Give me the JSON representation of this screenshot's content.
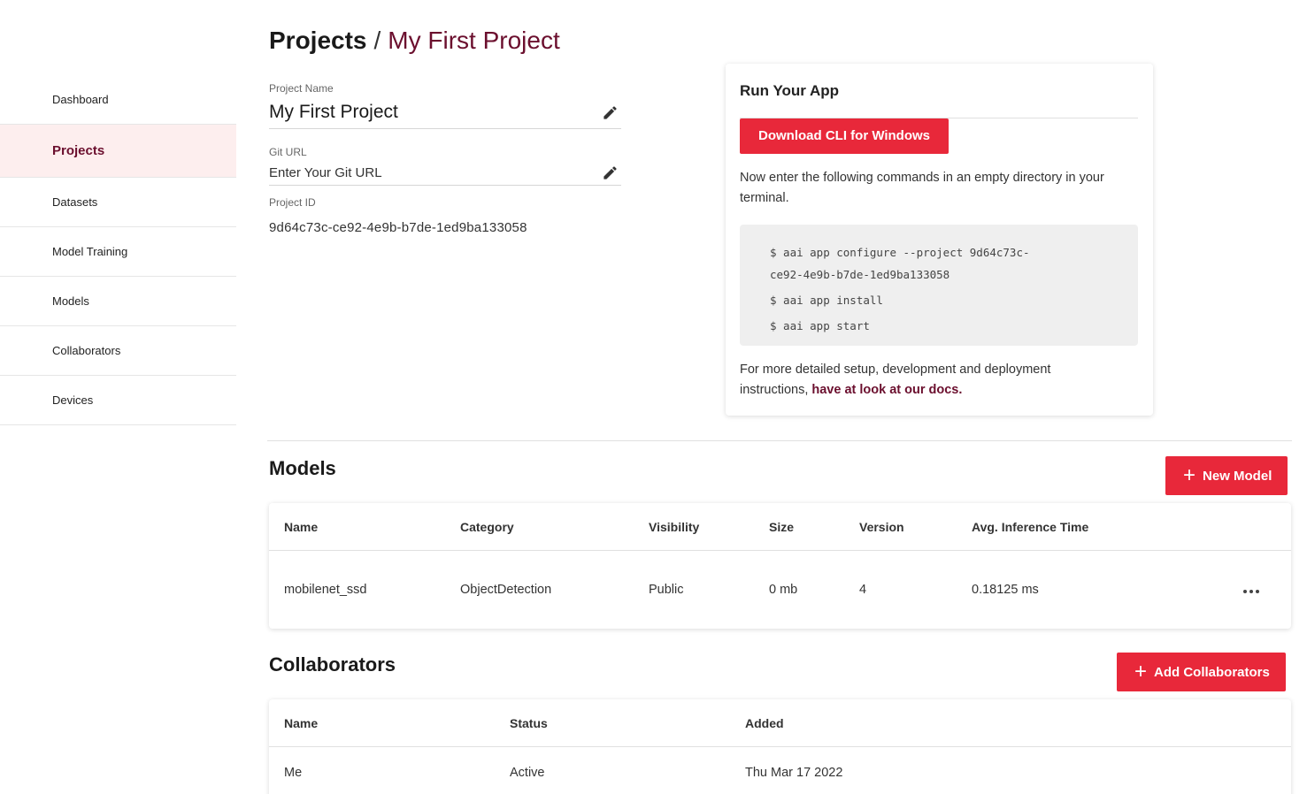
{
  "sidebar": {
    "items": [
      {
        "label": "Dashboard"
      },
      {
        "label": "Projects"
      },
      {
        "label": "Datasets"
      },
      {
        "label": "Model Training"
      },
      {
        "label": "Models"
      },
      {
        "label": "Collaborators"
      },
      {
        "label": "Devices"
      }
    ],
    "active": "Projects"
  },
  "header": {
    "breadcrumb_root": "Projects",
    "separator": "/",
    "breadcrumb_current": "My First Project"
  },
  "project": {
    "name_label": "Project Name",
    "name_value": "My First Project",
    "git_label": "Git URL",
    "git_placeholder": "Enter Your Git URL",
    "id_label": "Project ID",
    "id_value": "9d64c73c-ce92-4e9b-b7de-1ed9ba133058"
  },
  "run_app": {
    "title": "Run Your App",
    "download_label": "Download CLI for Windows",
    "instructions": "Now enter the following commands in an empty directory in your terminal.",
    "commands": [
      "$ aai app configure --project 9d64c73c-",
      "ce92-4e9b-b7de-1ed9ba133058",
      "$ aai app install",
      "$ aai app start"
    ],
    "footer_text": "For more detailed setup, development and deployment instructions,",
    "footer_link": "have at look at our docs."
  },
  "models": {
    "title": "Models",
    "add_label": "New Model",
    "columns": [
      "Name",
      "Category",
      "Visibility",
      "Size",
      "Version",
      "Avg. Inference Time"
    ],
    "rows": [
      {
        "name": "mobilenet_ssd",
        "category": "ObjectDetection",
        "visibility": "Public",
        "size": "0 mb",
        "version": "4",
        "avg_inference": "0.18125 ms"
      }
    ]
  },
  "collaborators": {
    "title": "Collaborators",
    "add_label": "Add Collaborators",
    "columns": [
      "Name",
      "Status",
      "Added"
    ],
    "rows": [
      {
        "name": "Me",
        "status": "Active",
        "added": "Thu Mar 17 2022"
      }
    ]
  },
  "colors": {
    "accent": "#e8283a",
    "brand": "#6b0f2e",
    "active_bg": "#fdeeee"
  },
  "icons": {
    "edit": "pencil-icon",
    "more": "more-horizontal-icon",
    "plus": "plus-icon"
  }
}
